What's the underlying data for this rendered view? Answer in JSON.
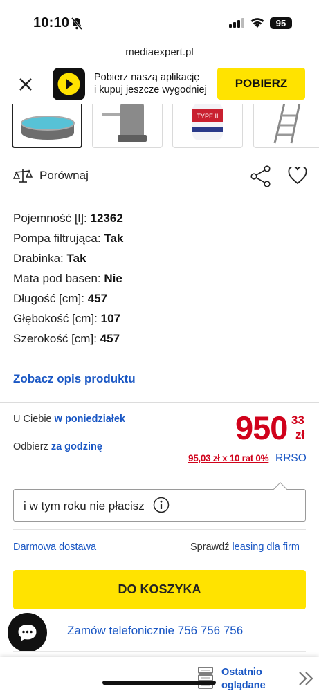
{
  "status_bar": {
    "time": "10:10",
    "battery": "95",
    "icons": [
      "bell-slash-icon",
      "signal-icon",
      "wifi-icon",
      "battery-icon"
    ]
  },
  "browser": {
    "url": "mediaexpert.pl"
  },
  "app_banner": {
    "line1": "Pobierz naszą aplikację",
    "line2": "i kupuj jeszcze wygodniej",
    "button": "POBIERZ"
  },
  "thumbnails": [
    {
      "name": "pool",
      "active": true
    },
    {
      "name": "filter-pump",
      "active": false
    },
    {
      "name": "filter-cartridge",
      "active": false
    },
    {
      "name": "ladder",
      "active": false
    }
  ],
  "cartridge_label": "TYPE II",
  "compare": {
    "label": "Porównaj"
  },
  "specs": [
    {
      "label": "Pojemność [l]:",
      "value": "12362"
    },
    {
      "label": "Pompa filtrująca:",
      "value": "Tak"
    },
    {
      "label": "Drabinka:",
      "value": "Tak"
    },
    {
      "label": "Mata pod basen:",
      "value": "Nie"
    },
    {
      "label": "Długość [cm]:",
      "value": "457"
    },
    {
      "label": "Głębokość [cm]:",
      "value": "107"
    },
    {
      "label": "Szerokość [cm]:",
      "value": "457"
    }
  ],
  "description_link": "Zobacz opis produktu",
  "delivery": {
    "prefix": "U Ciebie",
    "value": "w poniedziałek"
  },
  "pickup": {
    "prefix": "Odbierz",
    "value": "za godzinę"
  },
  "price": {
    "main": "950",
    "cents": "33",
    "currency": "zł"
  },
  "installment": {
    "text": "95,03 zł x 10 rat 0%",
    "rrso": "RRSO"
  },
  "tooltip": {
    "text": "i w tym roku nie płacisz"
  },
  "free_delivery": "Darmowa dostawa",
  "leasing": {
    "prefix": "Sprawdź",
    "link": "leasing dla firm"
  },
  "cart_button": "DO KOSZYKA",
  "phone_order": "Zamów telefonicznie 756 756 756",
  "recent": {
    "line1": "Ostatnio",
    "line2": "oglądane"
  },
  "colors": {
    "accent_yellow": "#ffe300",
    "price_red": "#d0021b",
    "link_blue": "#1a57c4"
  }
}
